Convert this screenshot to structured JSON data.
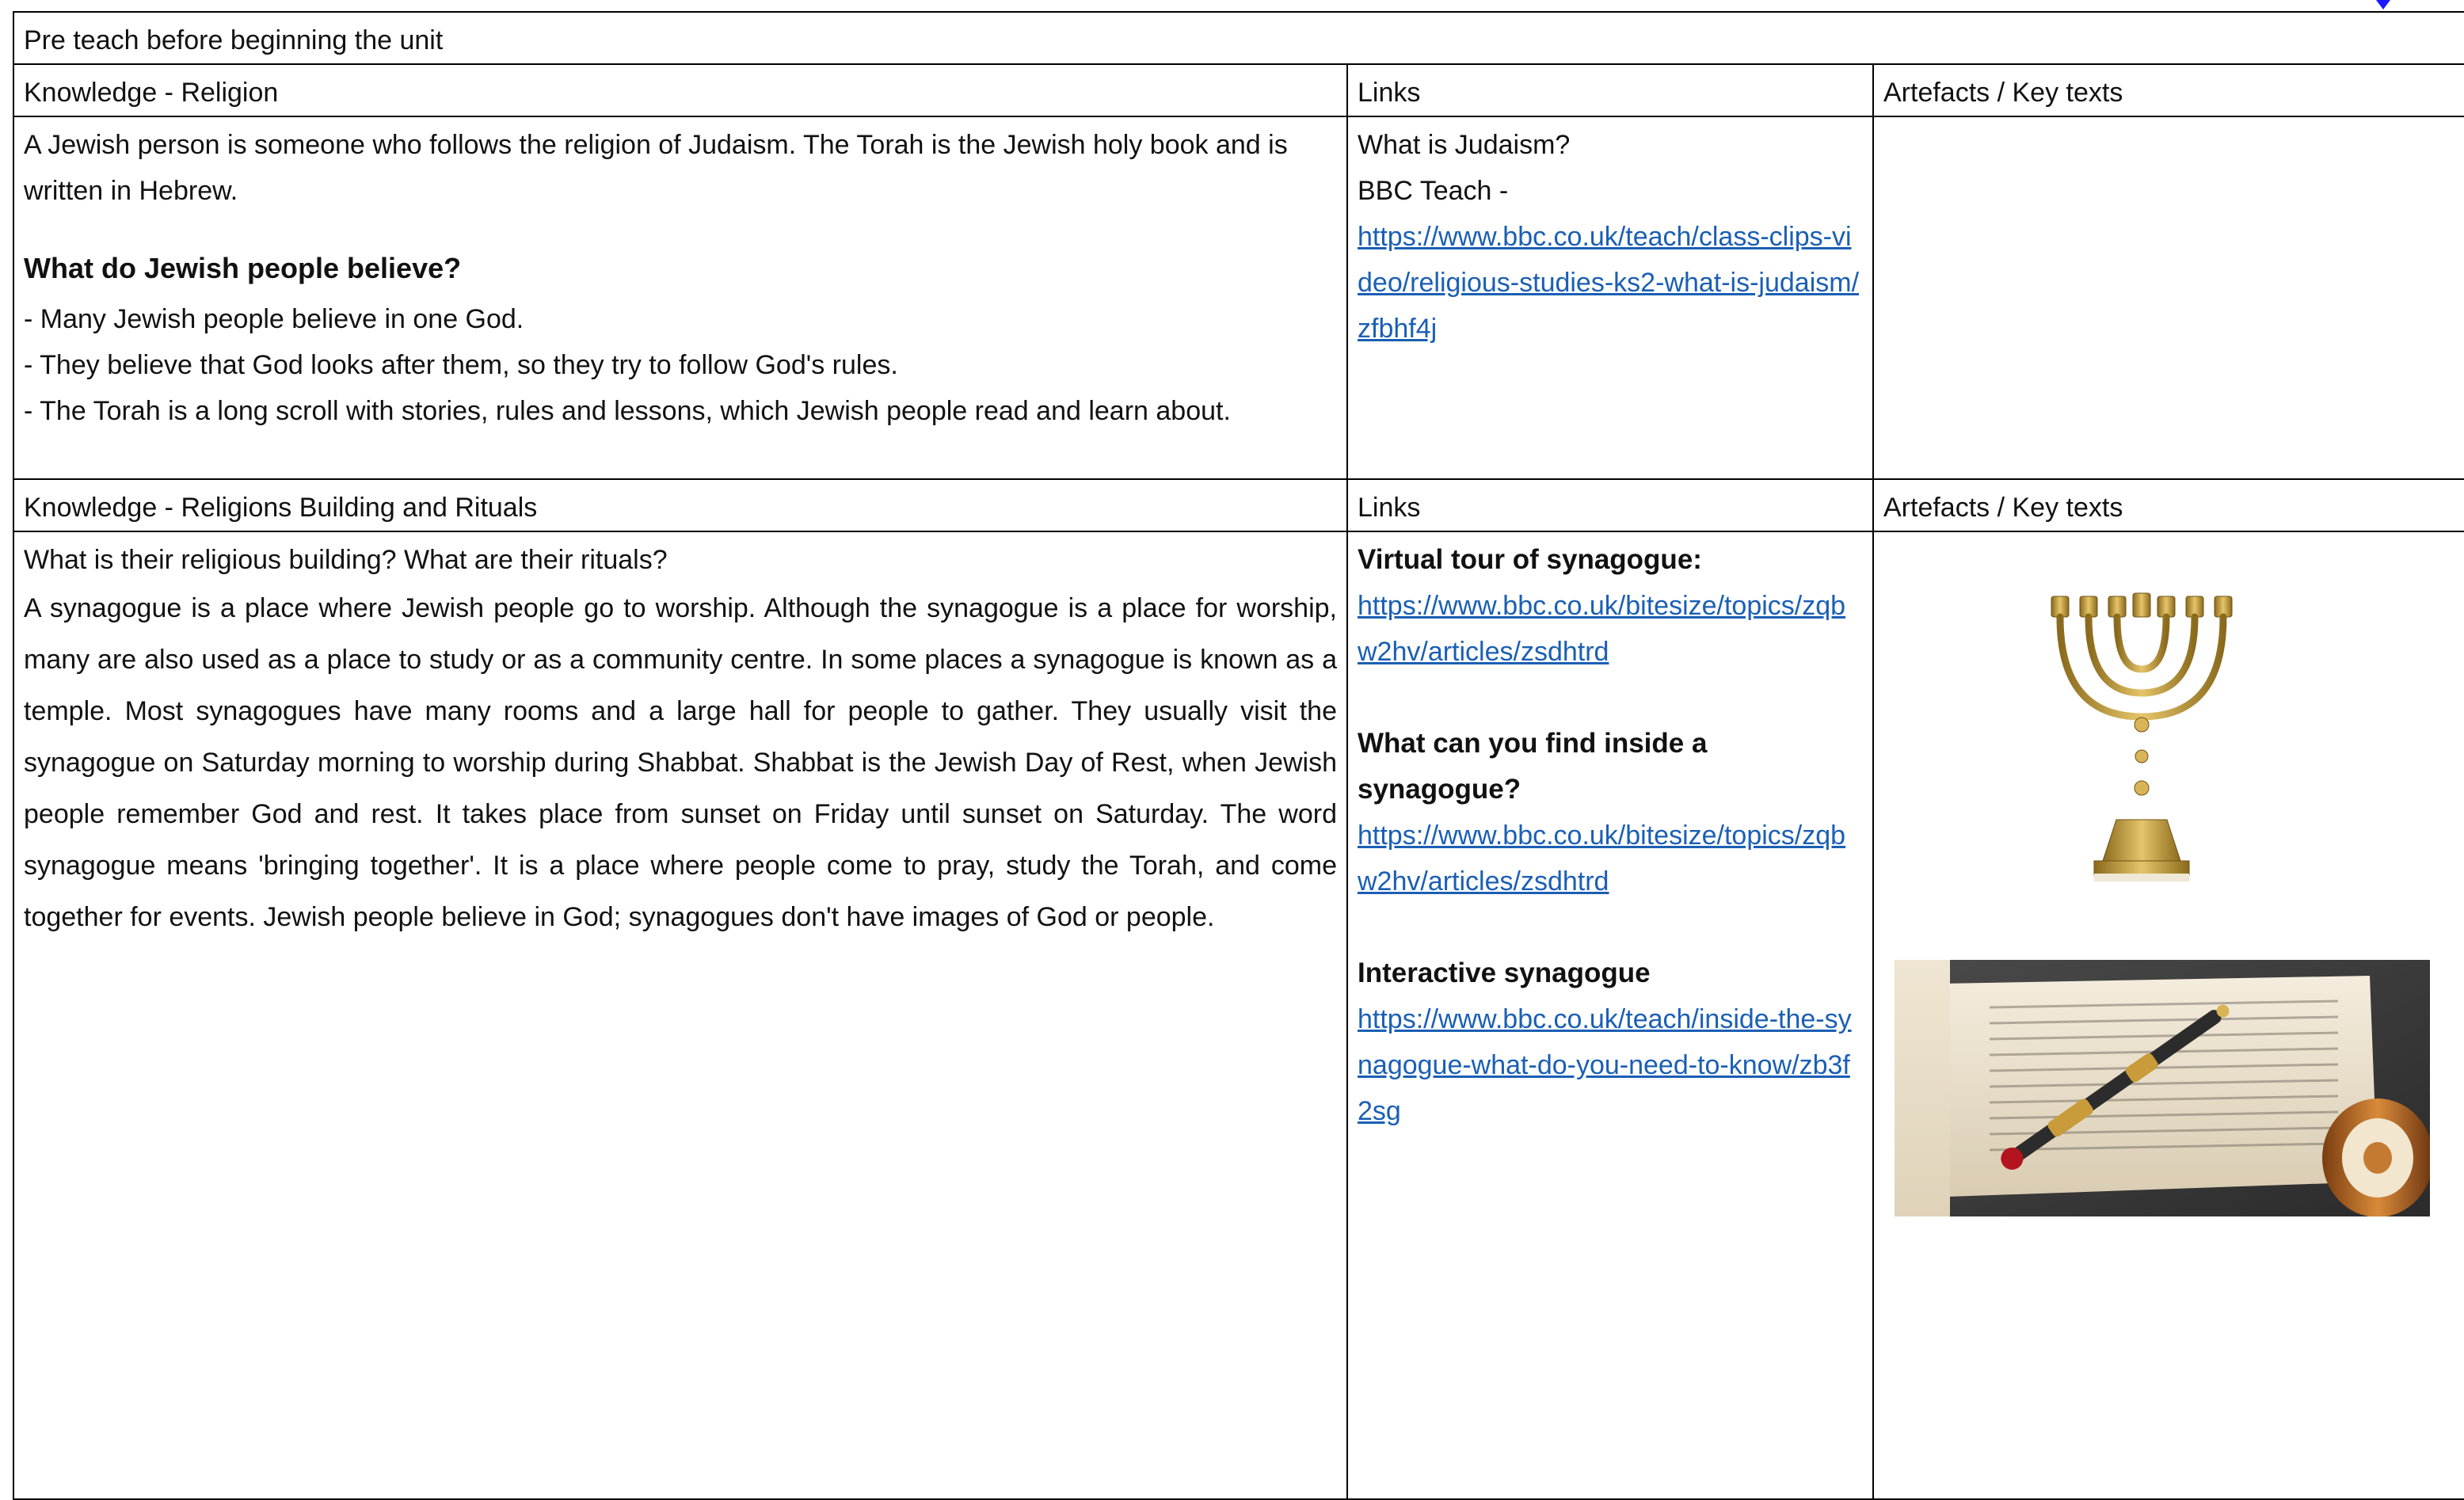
{
  "title": "Pre teach before beginning the unit",
  "section1": {
    "headers": {
      "knowledge": "Knowledge  - Religion",
      "links": "Links",
      "artefacts": "Artefacts / Key texts"
    },
    "intro": "A Jewish person is someone who follows the religion of Judaism. The Torah is the Jewish holy book and is written in Hebrew.",
    "beliefs_heading": "What do Jewish people believe?",
    "bullets": [
      "- Many Jewish people believe in one God.",
      "- They believe that God looks after them, so they try to follow God's rules.",
      "- The Torah is a long scroll with stories, rules and lessons, which Jewish people read and learn about."
    ],
    "links": {
      "label1": "What is Judaism?",
      "label2": "BBC Teach -",
      "url": "https://www.bbc.co.uk/teach/class-clips-video/religious-studies-ks2-what-is-judaism/zfbhf4j"
    }
  },
  "section2": {
    "headers": {
      "knowledge": "Knowledge - Religions Building and Rituals",
      "links": "Links",
      "artefacts": "Artefacts / Key texts"
    },
    "question": "What is their religious building? What are their rituals?",
    "body": "A synagogue is a place where Jewish people go to worship. Although the synagogue is a place for worship, many are also used as a place to study or as a community centre. In some places a synagogue is known as a temple. Most synagogues have many rooms and a large hall for people to gather. They usually visit the synagogue on Saturday morning to worship during Shabbat. Shabbat is the Jewish Day of Rest, when Jewish people remember God and rest. It takes place from sunset on Friday until sunset on Saturday. The word synagogue means 'bringing together'. It is a place where people come to pray, study the Torah, and come together for events. Jewish people believe in God; synagogues don't have images of God or people.",
    "links": [
      {
        "label": "Virtual tour of synagogue:",
        "url": "https://www.bbc.co.uk/bitesize/topics/zqbw2hv/articles/zsdhtrd"
      },
      {
        "label": "What can you find inside a synagogue?",
        "url": "https://www.bbc.co.uk/bitesize/topics/zqbw2hv/articles/zsdhtrd"
      },
      {
        "label": "Interactive synagogue",
        "url": "https://www.bbc.co.uk/teach/inside-the-synagogue-what-do-you-need-to-know/zb3f2sg"
      }
    ]
  },
  "colors": {
    "link": "#1a5fb4",
    "border": "#000000",
    "gold": "#c9a23a"
  }
}
